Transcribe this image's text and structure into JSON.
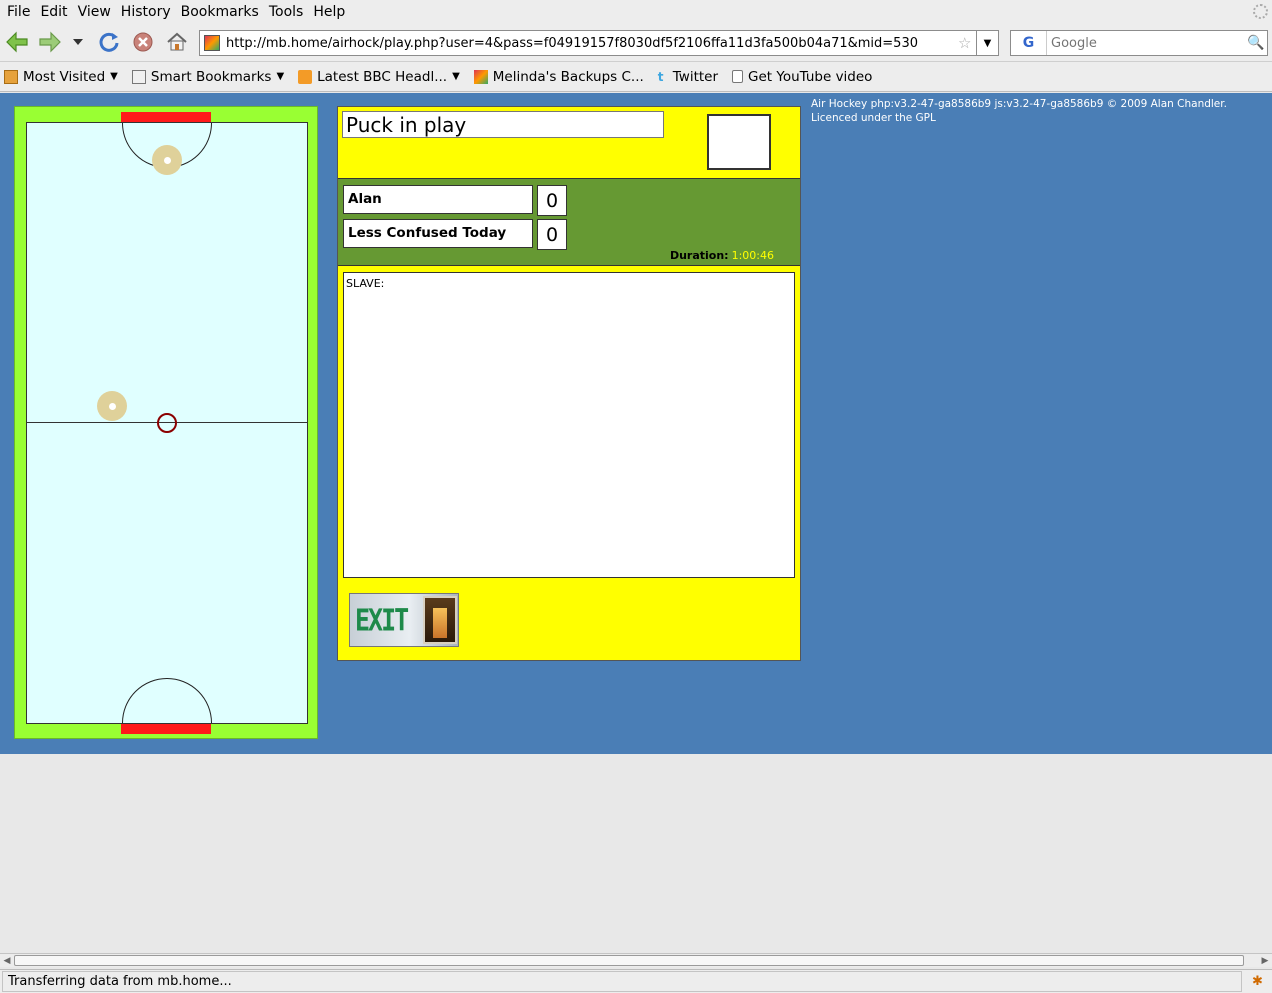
{
  "menu": [
    "File",
    "Edit",
    "View",
    "History",
    "Bookmarks",
    "Tools",
    "Help"
  ],
  "nav": {
    "url": "http://mb.home/airhock/play.php?user=4&pass=f04919157f8030df5f2106ffa11d3fa500b04a71&mid=530",
    "search_placeholder": "Google",
    "search_engine": "G"
  },
  "bookmarks": [
    {
      "label": "Most Visited",
      "has_menu": true
    },
    {
      "label": "Smart Bookmarks",
      "has_menu": true
    },
    {
      "label": "Latest BBC Headl...",
      "has_menu": true
    },
    {
      "label": "Melinda's Backups C..."
    },
    {
      "label": "Twitter"
    },
    {
      "label": "Get YouTube video"
    }
  ],
  "game": {
    "status": "Puck in play",
    "players": [
      {
        "name": "Alan",
        "score": "0"
      },
      {
        "name": "Less Confused Today",
        "score": "0"
      }
    ],
    "duration_label": "Duration:",
    "duration_value": "1:00:46",
    "log_text": "SLAVE:",
    "exit_label": "EXIT"
  },
  "copyright": {
    "line1": "Air Hockey php:v3.2-47-ga8586b9 js:v3.2-47-ga8586b9 © 2009 Alan Chandler.",
    "line2": "Licenced under the GPL"
  },
  "status_bar": "Transferring data from mb.home...",
  "colors": {
    "page_bg": "#4a7eb6",
    "rink_border": "#99ff33",
    "rink_surface": "#e0ffff",
    "goal": "#ff1a1a",
    "panel": "#ffff00",
    "scoreboard": "#669933",
    "mallet": "#dfd19a",
    "puck": "#8b0000"
  },
  "icons": [
    "back-icon",
    "forward-icon",
    "history-dropdown-icon",
    "reload-icon",
    "stop-icon",
    "home-icon",
    "bookmark-star-icon",
    "search-icon"
  ]
}
